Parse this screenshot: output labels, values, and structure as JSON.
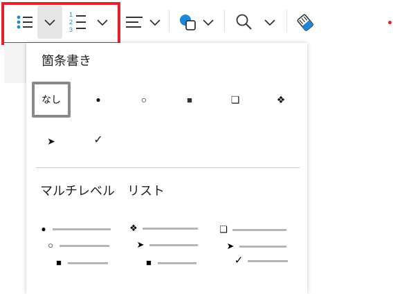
{
  "toolbar": {
    "buttons": [
      {
        "name": "bullet-list-icon"
      },
      {
        "name": "bullet-list-dropdown-chevron"
      },
      {
        "name": "numbered-list-icon",
        "digits": [
          "1",
          "2",
          "3"
        ]
      },
      {
        "name": "numbered-list-dropdown-chevron"
      },
      {
        "name": "align-icon"
      },
      {
        "name": "align-dropdown-chevron"
      },
      {
        "name": "shapes-icon"
      },
      {
        "name": "shapes-dropdown-chevron"
      },
      {
        "name": "search-icon"
      },
      {
        "name": "search-dropdown-chevron"
      },
      {
        "name": "eraser-icon"
      }
    ],
    "accent_color": "#1e88d8",
    "highlight_color": "#e8202a"
  },
  "dropdown": {
    "bullets_section_title": "箇条書き",
    "bullets": [
      {
        "id": "none",
        "label": "なし",
        "selected": true
      },
      {
        "id": "filled-circle",
        "symbol": "●"
      },
      {
        "id": "hollow-circle",
        "symbol": "○"
      },
      {
        "id": "filled-square",
        "symbol": "■"
      },
      {
        "id": "shadow-square",
        "symbol": "❑"
      },
      {
        "id": "diamond-four",
        "symbol": "❖"
      },
      {
        "id": "arrowhead",
        "symbol": "➤"
      },
      {
        "id": "checkmark",
        "symbol": "✓"
      }
    ],
    "multilevel_section_title": "マルチレベル　リスト",
    "multilevel_lists": [
      {
        "id": "ml-1",
        "symbols": [
          "●",
          "○",
          "■"
        ]
      },
      {
        "id": "ml-2",
        "symbols": [
          "❖",
          "➤",
          "■"
        ]
      },
      {
        "id": "ml-3",
        "symbols": [
          "❑",
          "➤",
          "✓"
        ]
      }
    ]
  }
}
